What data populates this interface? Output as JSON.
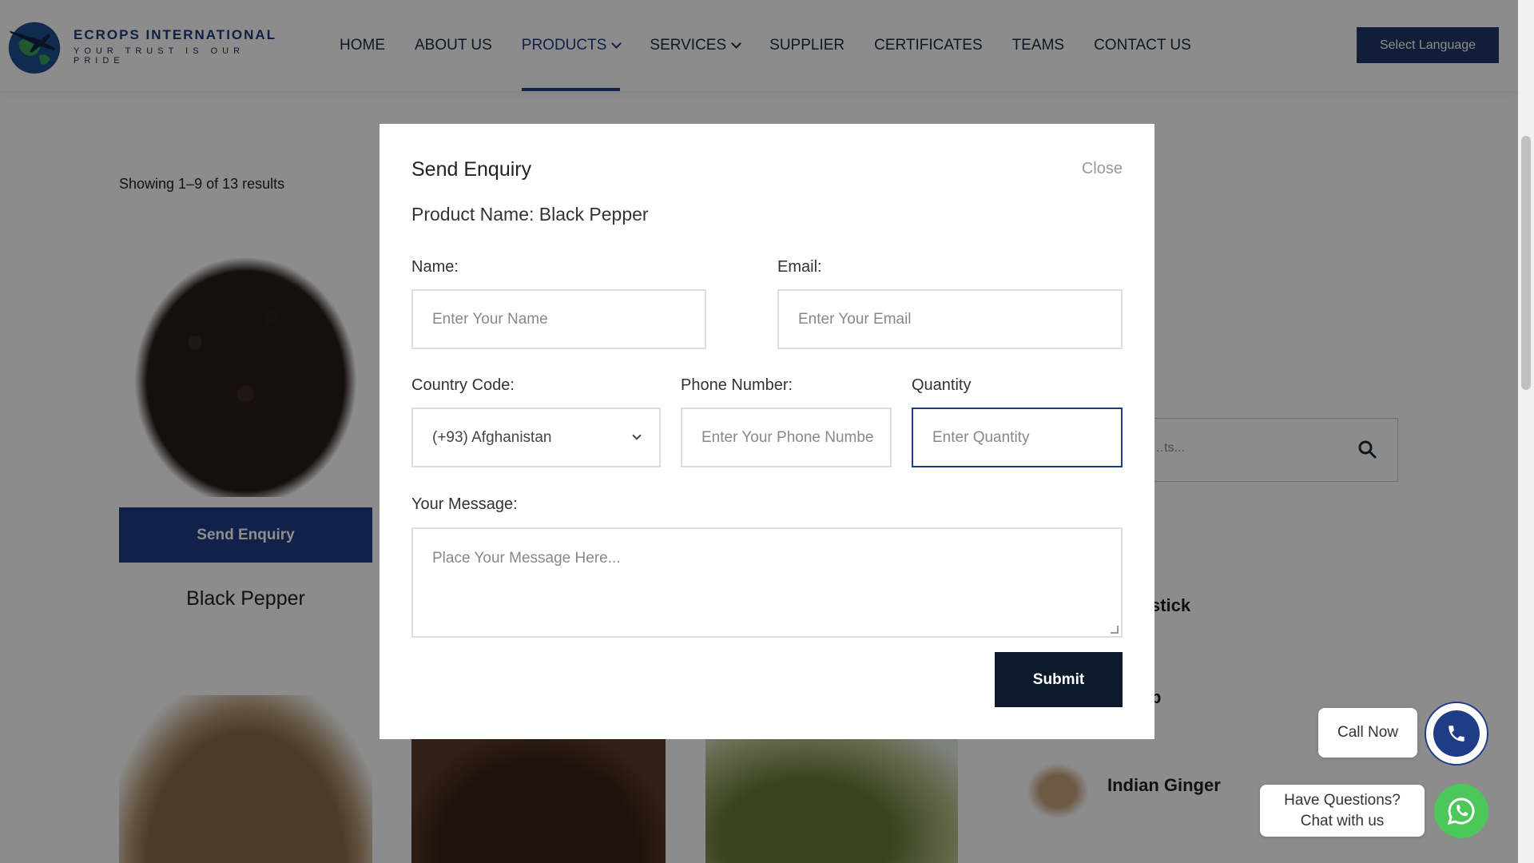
{
  "header": {
    "brand_title": "ECROPS INTERNATIONAL",
    "brand_tagline": "YOUR TRUST IS OUR PRIDE",
    "nav": [
      {
        "label": "HOME",
        "active": false,
        "dropdown": false
      },
      {
        "label": "ABOUT US",
        "active": false,
        "dropdown": false
      },
      {
        "label": "PRODUCTS",
        "active": true,
        "dropdown": true
      },
      {
        "label": "SERVICES",
        "active": false,
        "dropdown": true
      },
      {
        "label": "SUPPLIER",
        "active": false,
        "dropdown": false
      },
      {
        "label": "CERTIFICATES",
        "active": false,
        "dropdown": false
      },
      {
        "label": "TEAMS",
        "active": false,
        "dropdown": false
      },
      {
        "label": "CONTACT US",
        "active": false,
        "dropdown": false
      }
    ],
    "language_button": "Select Language"
  },
  "listing": {
    "results_text": "Showing 1–9 of 13 results",
    "featured_product": {
      "enquiry_button": "Send Enquiry",
      "name": "Black Pepper"
    }
  },
  "sidebar": {
    "search_placeholder": "…ts...",
    "partial_texts": [
      "s",
      "stick",
      "p"
    ],
    "ginger_label": "Indian Ginger"
  },
  "modal": {
    "title": "Send Enquiry",
    "close_label": "Close",
    "product_line": "Product Name: Black Pepper",
    "name_label": "Name:",
    "name_placeholder": "Enter Your Name",
    "email_label": "Email:",
    "email_placeholder": "Enter Your Email",
    "country_label": "Country Code:",
    "country_value": "(+93) Afghanistan",
    "phone_label": "Phone Number:",
    "phone_placeholder": "Enter Your Phone Numbe",
    "quantity_label": "Quantity",
    "quantity_placeholder": "Enter Quantity",
    "message_label": "Your Message:",
    "message_placeholder": "Place Your Message Here...",
    "submit_label": "Submit"
  },
  "floating": {
    "call_now": "Call Now",
    "chat_line1": "Have Questions?",
    "chat_line2": "Chat with us"
  },
  "colors": {
    "brand_blue": "#1f3c88",
    "dark_navy": "#0d1a2c",
    "whatsapp_green": "#4cc75a"
  }
}
